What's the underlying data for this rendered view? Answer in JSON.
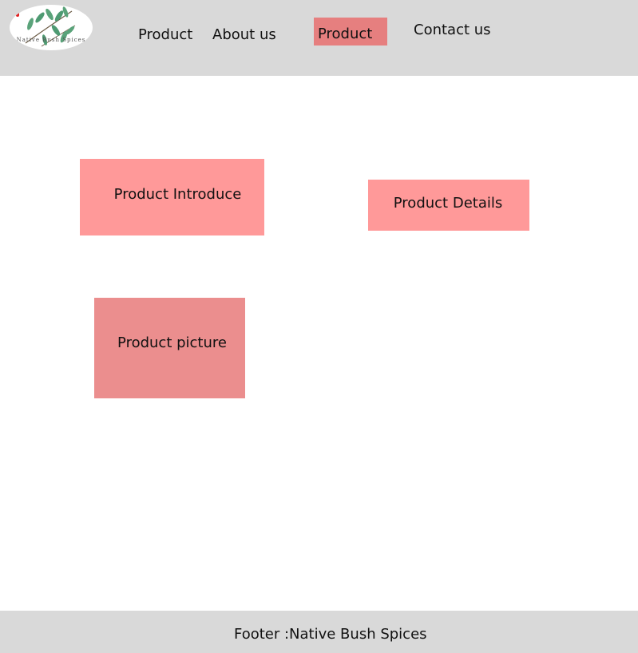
{
  "header": {
    "logo": {
      "text": "Native Bush Spices",
      "icon": "leaf-branch-icon"
    },
    "nav": {
      "product_1": "Product",
      "about_us": "About us",
      "product_2_active": "Product",
      "contact_us": "Contact us"
    }
  },
  "main": {
    "product_introduce": "Product Introduce",
    "product_details": "Product Details",
    "product_picture": "Product picture"
  },
  "footer": {
    "text": "Footer :Native Bush Spices"
  },
  "colors": {
    "header_bg": "#d9d9d9",
    "footer_bg": "#d9d9d9",
    "nav_active_bg": "#e67f7f",
    "block_bg": "#ff9999",
    "picture_block_bg": "#eb8e8e",
    "page_bg": "#ffffff"
  }
}
